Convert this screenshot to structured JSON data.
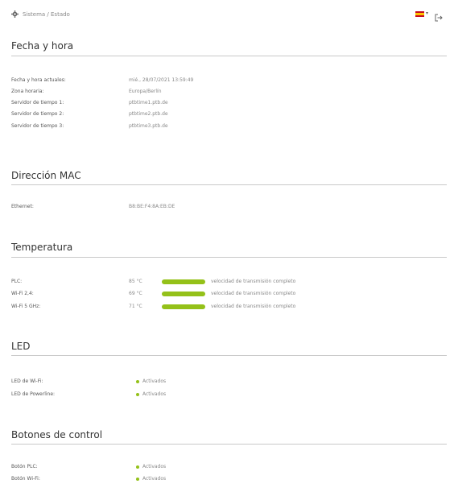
{
  "header": {
    "breadcrumb": "Sistema / Estado",
    "language_caret": "▾"
  },
  "colors": {
    "accent_green": "#94c119",
    "rule": "#c9c9c9"
  },
  "sections": {
    "datetime": {
      "title": "Fecha y hora",
      "rows": [
        {
          "label": "Fecha y hora actuales:",
          "value": "mié., 28/07/2021 13:59:49"
        },
        {
          "label": "Zona horaria:",
          "value": "Europa/Berlín"
        },
        {
          "label": "Servidor de tiempo 1:",
          "value": "ptbtime1.ptb.de"
        },
        {
          "label": "Servidor de tiempo 2:",
          "value": "ptbtime2.ptb.de"
        },
        {
          "label": "Servidor de tiempo 3:",
          "value": "ptbtime3.ptb.de"
        }
      ]
    },
    "mac": {
      "title": "Dirección MAC",
      "rows": [
        {
          "label": "Ethernet:",
          "value": "B8:BE:F4:8A:EB:DE"
        }
      ]
    },
    "temperature": {
      "title": "Temperatura",
      "rows": [
        {
          "label": "PLC:",
          "value": "85 °C",
          "status": "velocidad de transmisión completo",
          "level": 1.0
        },
        {
          "label": "Wi-Fi 2,4:",
          "value": "69 °C",
          "status": "velocidad de transmisión completo",
          "level": 1.0
        },
        {
          "label": "Wi-Fi 5 GHz:",
          "value": "71 °C",
          "status": "velocidad de transmisión completo",
          "level": 1.0
        }
      ]
    },
    "led": {
      "title": "LED",
      "rows": [
        {
          "label": "LED de Wi-Fi:",
          "value": "Activados"
        },
        {
          "label": "LED de Powerline:",
          "value": "Activados"
        }
      ]
    },
    "buttons": {
      "title": "Botones de control",
      "rows": [
        {
          "label": "Botón PLC:",
          "value": "Activados"
        },
        {
          "label": "Botón Wi-Fi:",
          "value": "Activados"
        }
      ]
    }
  }
}
